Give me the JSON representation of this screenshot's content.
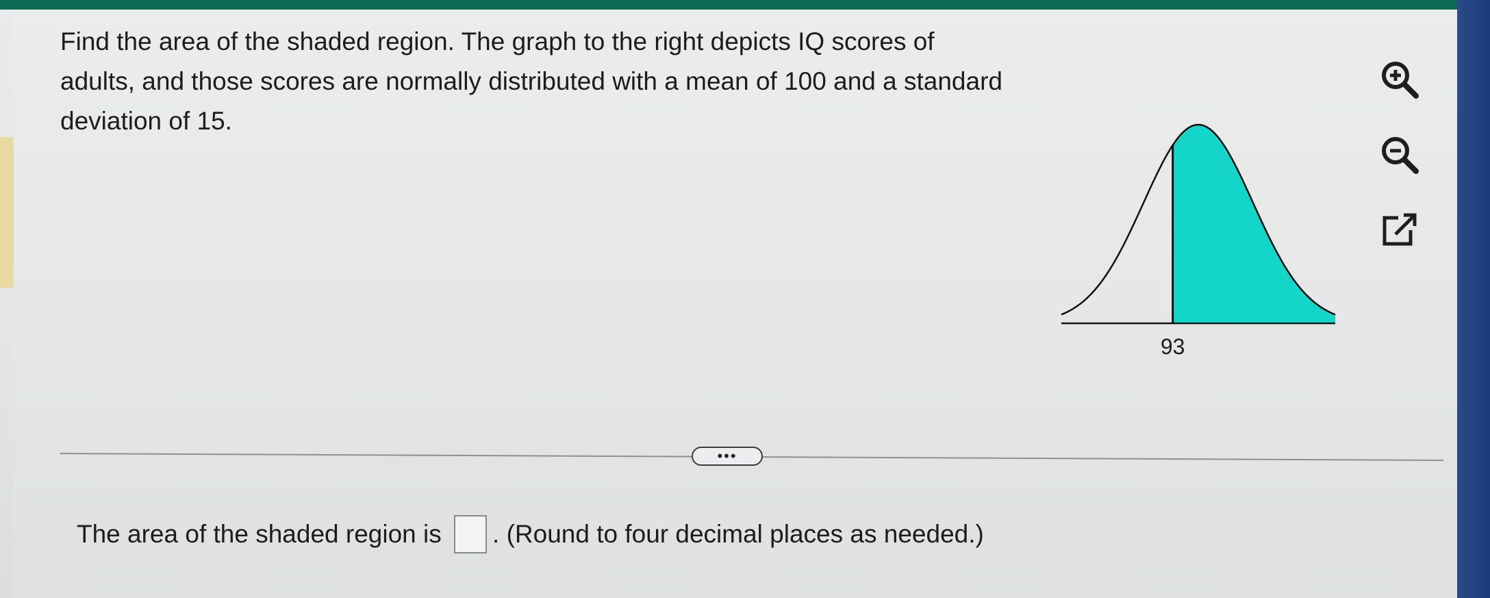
{
  "question": {
    "text": "Find the area of the shaded region. The graph to the right depicts IQ scores of adults, and those scores are normally distributed with a mean of 100 and a standard deviation of 15."
  },
  "chart_data": {
    "type": "area",
    "distribution": "normal",
    "mean": 100,
    "std_dev": 15,
    "shaded_from": 93,
    "shaded_side": "right",
    "tick_labels": [
      "93"
    ],
    "shade_color": "#14d6c8",
    "line_color": "#111111"
  },
  "toolbar": {
    "zoom_in_icon": "zoom-in-icon",
    "zoom_out_icon": "zoom-out-icon",
    "popout_icon": "external-link-icon"
  },
  "expand": {
    "label": "•••"
  },
  "answer": {
    "prefix": "The area of the shaded region is",
    "value": "",
    "suffix": ". (Round to four decimal places as needed.)"
  },
  "colors": {
    "top_bar": "#0e6a55",
    "accent": "#14d6c8",
    "tab": "#e7d9a0"
  }
}
